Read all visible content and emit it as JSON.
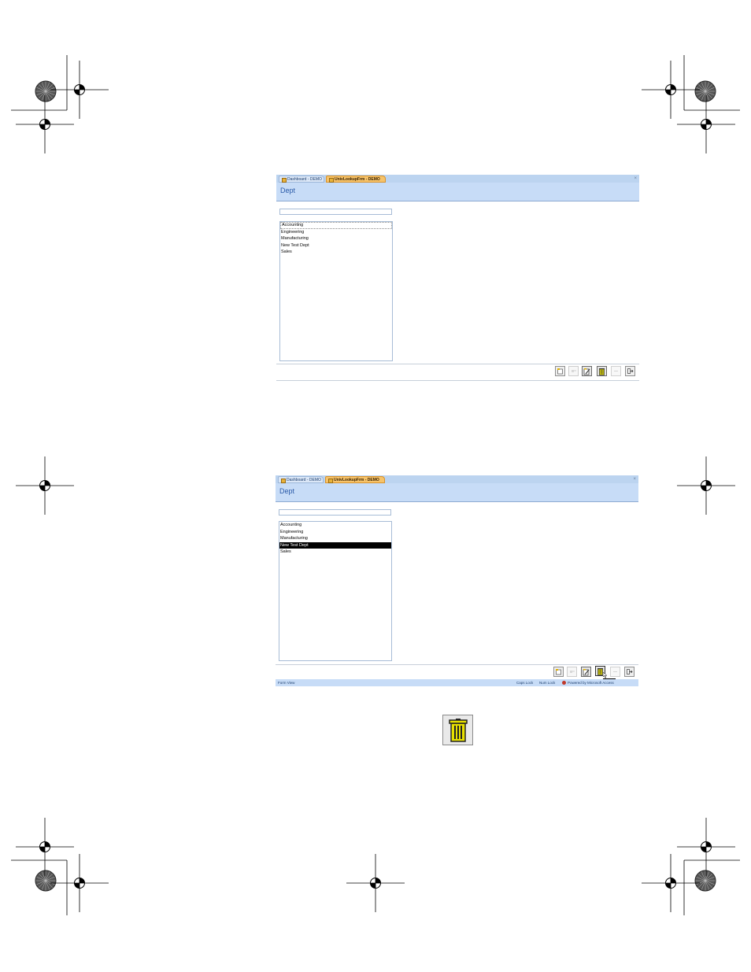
{
  "screens": [
    {
      "tabs": [
        {
          "label": "Dashboard - DEMO",
          "active": false
        },
        {
          "label": "UnivLookupFrm - DEMO",
          "active": true
        }
      ],
      "close_glyph": "×",
      "header_title": "Dept",
      "search_value": "",
      "items": [
        "Accounting",
        "Engineering",
        "Manufacturing",
        "New Test Dept",
        "Sales"
      ],
      "focused_index": 0,
      "selected_index": -1
    },
    {
      "tabs": [
        {
          "label": "Dashboard - DEMO",
          "active": false
        },
        {
          "label": "UnivLookupFrm - DEMO",
          "active": true
        }
      ],
      "close_glyph": "×",
      "header_title": "Dept",
      "search_value": "",
      "items": [
        "Accounting",
        "Engineering",
        "Manufacturing",
        "New Test Dept",
        "Sales"
      ],
      "focused_index": -1,
      "selected_index": 3,
      "status": {
        "left": "Form View",
        "caps": "Caps Lock",
        "num": "Num Lock",
        "powered": "Powered by Microsoft Access"
      },
      "tooltip": "Delete"
    }
  ],
  "toolbar": [
    {
      "name": "new-record-icon",
      "enabled": true
    },
    {
      "name": "undo-record-icon",
      "enabled": false
    },
    {
      "name": "edit-record-icon",
      "enabled": true
    },
    {
      "name": "delete-record-icon",
      "enabled": true
    },
    {
      "name": "back-icon",
      "enabled": false
    },
    {
      "name": "exit-form-icon",
      "enabled": true
    }
  ],
  "colors": {
    "tab_active": "#f6c36a",
    "header_bg": "#c7dcf7",
    "title_text": "#2a5aa8",
    "trash_yellow": "#e8e000"
  }
}
